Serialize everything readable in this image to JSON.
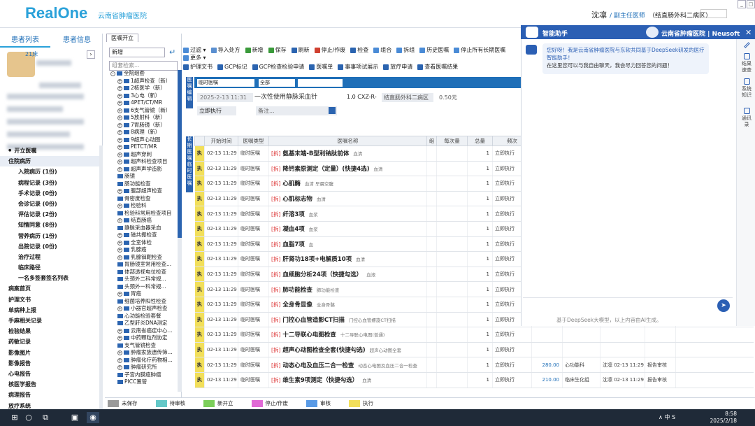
{
  "header": {
    "logo": "RealOne",
    "hospital": "云南省肿瘤医院",
    "user_name": "沈凛",
    "user_title": "/ 副主任医师",
    "dept": "（结直肠外科二病区）",
    "win": [
      "_",
      "□"
    ]
  },
  "left": {
    "tabs": [
      "患者列表",
      "患者信息"
    ],
    "bed": "21床",
    "nav": [
      {
        "label": "开立医嘱",
        "type": "dot"
      },
      {
        "label": "住院病历",
        "type": "sec"
      },
      {
        "label": "入院病历 (1份)",
        "type": "sub"
      },
      {
        "label": "病程记录 (3份)",
        "type": "sub"
      },
      {
        "label": "手术记录 (0份)",
        "type": "sub"
      },
      {
        "label": "会诊记录 (0份)",
        "type": "sub"
      },
      {
        "label": "评估记录 (2份)",
        "type": "sub"
      },
      {
        "label": "知情同意 (8份)",
        "type": "sub"
      },
      {
        "label": "营养病历 (1份)",
        "type": "sub"
      },
      {
        "label": "出院记录 (0份)",
        "type": "sub"
      },
      {
        "label": "治疗过程",
        "type": "sub"
      },
      {
        "label": "临床路径",
        "type": "sub"
      },
      {
        "label": "一名多签套签名列表",
        "type": "sub"
      },
      {
        "label": "病案首页",
        "type": "top"
      },
      {
        "label": "护理文书",
        "type": "top"
      },
      {
        "label": "单病种上报",
        "type": "top"
      },
      {
        "label": "手麻相关记录",
        "type": "top"
      },
      {
        "label": "检验结果",
        "type": "top"
      },
      {
        "label": "药敏记录",
        "type": "top"
      },
      {
        "label": "影像图片",
        "type": "top"
      },
      {
        "label": "影像报告",
        "type": "top"
      },
      {
        "label": "心电报告",
        "type": "top"
      },
      {
        "label": "核医学报告",
        "type": "top"
      },
      {
        "label": "病理报告",
        "type": "top"
      },
      {
        "label": "放疗系统",
        "type": "top"
      }
    ]
  },
  "tree": {
    "tab": "医嘱开立",
    "new_label": "新增",
    "search_placeholder": "组套检索...",
    "nodes": [
      {
        "label": "全院组套",
        "lvl": 1,
        "pm": "-"
      },
      {
        "label": "1超声检查（新）",
        "lvl": 2,
        "pm": "+"
      },
      {
        "label": "2核医学（新）",
        "lvl": 2,
        "pm": "+"
      },
      {
        "label": "3心电（新）",
        "lvl": 2,
        "pm": "+"
      },
      {
        "label": "4PET/CT/MR",
        "lvl": 2,
        "pm": "+"
      },
      {
        "label": "6支气管镜（新）",
        "lvl": 2,
        "pm": "+"
      },
      {
        "label": "5放射科（新）",
        "lvl": 2,
        "pm": "+"
      },
      {
        "label": "7胃肠镜（新）",
        "lvl": 2,
        "pm": "+"
      },
      {
        "label": "8病理（新）",
        "lvl": 2,
        "pm": "+"
      },
      {
        "label": "9超声心动图",
        "lvl": 2,
        "pm": "+"
      },
      {
        "label": "PETCT/MR",
        "lvl": 2,
        "pm": "+"
      },
      {
        "label": "超声穿刺",
        "lvl": 2,
        "pm": "+"
      },
      {
        "label": "超声科检查项目",
        "lvl": 2,
        "pm": "+"
      },
      {
        "label": "超声声学造影",
        "lvl": 2,
        "pm": "+"
      },
      {
        "label": "肠镜",
        "lvl": 2,
        "pm": ""
      },
      {
        "label": "肠功能检查",
        "lvl": 2,
        "pm": ""
      },
      {
        "label": "腹部超声检查",
        "lvl": 2,
        "pm": "+"
      },
      {
        "label": "骨密度检查",
        "lvl": 2,
        "pm": ""
      },
      {
        "label": "检验科",
        "lvl": 2,
        "pm": "+"
      },
      {
        "label": "检验科常用检查项目",
        "lvl": 2,
        "pm": ""
      },
      {
        "label": "结直肠癌",
        "lvl": 2,
        "pm": "+"
      },
      {
        "label": "静脉采血器采血",
        "lvl": 2,
        "pm": ""
      },
      {
        "label": "磁共振检查",
        "lvl": 2,
        "pm": "+"
      },
      {
        "label": "全室体检",
        "lvl": 2,
        "pm": "+"
      },
      {
        "label": "乳腺癌",
        "lvl": 2,
        "pm": "+"
      },
      {
        "label": "乳腺钼靶检查",
        "lvl": 2,
        "pm": "+"
      },
      {
        "label": "胃肠镜室常用检查...",
        "lvl": 2,
        "pm": ""
      },
      {
        "label": "体部透视电位检查",
        "lvl": 2,
        "pm": ""
      },
      {
        "label": "头颈外二科常规...",
        "lvl": 2,
        "pm": ""
      },
      {
        "label": "头颈外一科常规...",
        "lvl": 2,
        "pm": ""
      },
      {
        "label": "胃癌",
        "lvl": 2,
        "pm": "+"
      },
      {
        "label": "细菌培养阳性检查",
        "lvl": 2,
        "pm": ""
      },
      {
        "label": "小器官超声检查",
        "lvl": 2,
        "pm": "+"
      },
      {
        "label": "心功能检验套餐",
        "lvl": 2,
        "pm": ""
      },
      {
        "label": "乙型肝炎DNA测定",
        "lvl": 2,
        "pm": ""
      },
      {
        "label": "云南省癌症中心...",
        "lvl": 2,
        "pm": "+"
      },
      {
        "label": "中药颗粒剂协定",
        "lvl": 2,
        "pm": "+"
      },
      {
        "label": "支气管镜检查",
        "lvl": 2,
        "pm": ""
      },
      {
        "label": "肿瘤家族遗传筛...",
        "lvl": 2,
        "pm": "+"
      },
      {
        "label": "肿瘤化疗药物相...",
        "lvl": 2,
        "pm": "+"
      },
      {
        "label": "肿瘤研究所",
        "lvl": 2,
        "pm": "+"
      },
      {
        "label": "子宫内膜癌肿瘤",
        "lvl": 2,
        "pm": ""
      },
      {
        "label": "PICC置管",
        "lvl": 2,
        "pm": ""
      }
    ]
  },
  "toolbar": {
    "row1": [
      {
        "label": "过滤 ▾",
        "color": "#4a8bd6"
      },
      {
        "label": "导入处方",
        "color": "#5a8fd0"
      },
      {
        "label": "新增",
        "color": "#3a9a3a"
      },
      {
        "label": "保存",
        "color": "#3a9a3a"
      },
      {
        "label": "刷新",
        "color": "#2b64b0"
      },
      {
        "label": "停止/作废",
        "color": "#d04030"
      },
      {
        "label": "检查",
        "color": "#2b64b0"
      },
      {
        "label": "组合",
        "color": "#4a8bd6"
      },
      {
        "label": "拆组",
        "color": "#4a8bd6"
      },
      {
        "label": "历史医嘱",
        "color": "#4a8bd6"
      },
      {
        "label": "停止所有长期医嘱",
        "color": "#4a8bd6"
      },
      {
        "label": "更多 ▾",
        "color": "#4a8bd6"
      }
    ],
    "row2": [
      {
        "label": "护理文书",
        "color": "#2b64b0"
      },
      {
        "label": "GCP标记",
        "color": "#2b64b0"
      },
      {
        "label": "GCP检查检验申请",
        "color": "#2b64b0"
      },
      {
        "label": "医嘱单",
        "color": "#2b64b0"
      },
      {
        "label": "事事项试展示",
        "color": "#2b64b0"
      },
      {
        "label": "放疗申请",
        "color": "#2b64b0"
      },
      {
        "label": "查看医嘱结果",
        "color": "#2b64b0"
      }
    ]
  },
  "form": {
    "side_label": "医嘱编辑",
    "type": "临时医嘱",
    "scope": "全部",
    "date": "2025-2-13 11:31",
    "drug": "一次性使用静脉采血针",
    "qty": "1.0 CXZ-R-",
    "ward": "结直肠外科二病区",
    "dose": "0.50元",
    "immediate": "立即执行",
    "remark": "备注...",
    "side2": "长期医嘱 临时医嘱"
  },
  "table": {
    "headers": [
      "",
      "开始时间",
      "医嘱类型",
      "医嘱名称",
      "组",
      "每次量",
      "总量",
      "频次",
      "",
      "",
      "",
      "",
      ""
    ],
    "rows": [
      {
        "st": "执",
        "time": "02-13 11:29",
        "type": "临时医嘱",
        "tag": "[拆]",
        "name": "氨基末端-B型利钠肽前体",
        "sub": "血清",
        "qty": "1",
        "freq": "立即执行"
      },
      {
        "st": "执",
        "time": "02-13 11:29",
        "type": "临时医嘱",
        "tag": "[拆]",
        "name": "降钙素原测定（定量）(快捷4选)",
        "sub": "血清",
        "qty": "1",
        "freq": "立即执行"
      },
      {
        "st": "执",
        "time": "02-13 11:29",
        "type": "临时医嘱",
        "tag": "[拆]",
        "name": "心肌酶",
        "sub": "血清 早晨空腹",
        "qty": "1",
        "freq": "立即执行"
      },
      {
        "st": "执",
        "time": "02-13 11:29",
        "type": "临时医嘱",
        "tag": "[拆]",
        "name": "心肌标志物",
        "sub": "血清",
        "qty": "1",
        "freq": "立即执行"
      },
      {
        "st": "执",
        "time": "02-13 11:29",
        "type": "临时医嘱",
        "tag": "[拆]",
        "name": "纤溶3项",
        "sub": "血浆",
        "qty": "1",
        "freq": "立即执行"
      },
      {
        "st": "执",
        "time": "02-13 11:29",
        "type": "临时医嘱",
        "tag": "[拆]",
        "name": "凝血4项",
        "sub": "血浆",
        "qty": "1",
        "freq": "立即执行"
      },
      {
        "st": "执",
        "time": "02-13 11:29",
        "type": "临时医嘱",
        "tag": "[拆]",
        "name": "血脂7项",
        "sub": "血",
        "qty": "1",
        "freq": "立即执行"
      },
      {
        "st": "执",
        "time": "02-13 11:29",
        "type": "临时医嘱",
        "tag": "[拆]",
        "name": "肝肾功18项+电解质10项",
        "sub": "血清",
        "qty": "1",
        "freq": "立即执行"
      },
      {
        "st": "执",
        "time": "02-13 11:29",
        "type": "临时医嘱",
        "tag": "[拆]",
        "name": "血细胞分析24项（快捷勾选）",
        "sub": "血液",
        "qty": "1",
        "freq": "立即执行"
      },
      {
        "st": "执",
        "time": "02-13 11:29",
        "type": "临时医嘱",
        "tag": "[拆]",
        "name": "肺功能检查",
        "sub": "肺功能检查",
        "qty": "1",
        "freq": "立即执行"
      },
      {
        "st": "执",
        "time": "02-13 11:29",
        "type": "临时医嘱",
        "tag": "[拆]",
        "name": "全身骨显像",
        "sub": "全身骨骼",
        "qty": "1",
        "freq": "立即执行"
      },
      {
        "st": "执",
        "time": "02-13 11:29",
        "type": "临时医嘱",
        "tag": "[拆]",
        "name": "门控心血管造影CT扫描",
        "sub": "门控心血管螺旋CT扫描",
        "qty": "1",
        "freq": "立即执行"
      },
      {
        "st": "执",
        "time": "02-13 11:29",
        "type": "临时医嘱",
        "tag": "[拆]",
        "name": "十二导联心电图检查",
        "sub": "十二导联心电图(普通)",
        "qty": "1",
        "freq": "立即执行"
      },
      {
        "st": "执",
        "time": "02-13 11:29",
        "type": "临时医嘱",
        "tag": "[拆]",
        "name": "超声心动图检查全套(快捷勾选)",
        "sub": "超声心动图全套",
        "qty": "1",
        "freq": "立即执行"
      },
      {
        "st": "执",
        "time": "02-13 11:29",
        "type": "临时医嘱",
        "tag": "[拆]",
        "name": "动态心电及血压二合一检查",
        "sub": "动态心电图及血压二合一检查",
        "qty": "1",
        "freq": "立即执行",
        "price": "280.00",
        "dept": "心功能科",
        "doc": "沈凛 02-13 11:29",
        "rep": "报告审核"
      },
      {
        "st": "执",
        "time": "02-13 11:29",
        "type": "临时医嘱",
        "tag": "[拆]",
        "name": "维生素9项测定（快捷勾选）",
        "sub": "血清",
        "qty": "1",
        "freq": "立即执行",
        "price": "210.00",
        "dept": "临床生化组",
        "doc": "沈凛 02-13 11:29",
        "rep": "报告审核"
      }
    ]
  },
  "legend": [
    {
      "label": "未保存",
      "color": "#9a9a9a"
    },
    {
      "label": "待审核",
      "color": "#64c8c8"
    },
    {
      "label": "新开立",
      "color": "#7ccf5a"
    },
    {
      "label": "停止/作废",
      "color": "#e16ad6"
    },
    {
      "label": "审核",
      "color": "#5a9be6"
    },
    {
      "label": "执行",
      "color": "#f2df5a"
    }
  ],
  "chat": {
    "title": "智能助手",
    "hospital": "云南省肿瘤医院 | Neusoft",
    "msg1": "您好呀！我是云南省肿瘤医院与东软共同基于DeepSeek研发的医疗智能助手！",
    "msg2": "在这里您可以与我自由聊天，我会尽力回答您的问题！",
    "footer": "基于DeepSeek大模型，以上内容由AI生成。",
    "side": [
      "结果 速查",
      "系统 知识",
      "通讯 录"
    ]
  },
  "taskbar": {
    "clock_time": "8:58",
    "clock_date": "2025/2/18",
    "tray": "∧ 中 S"
  }
}
